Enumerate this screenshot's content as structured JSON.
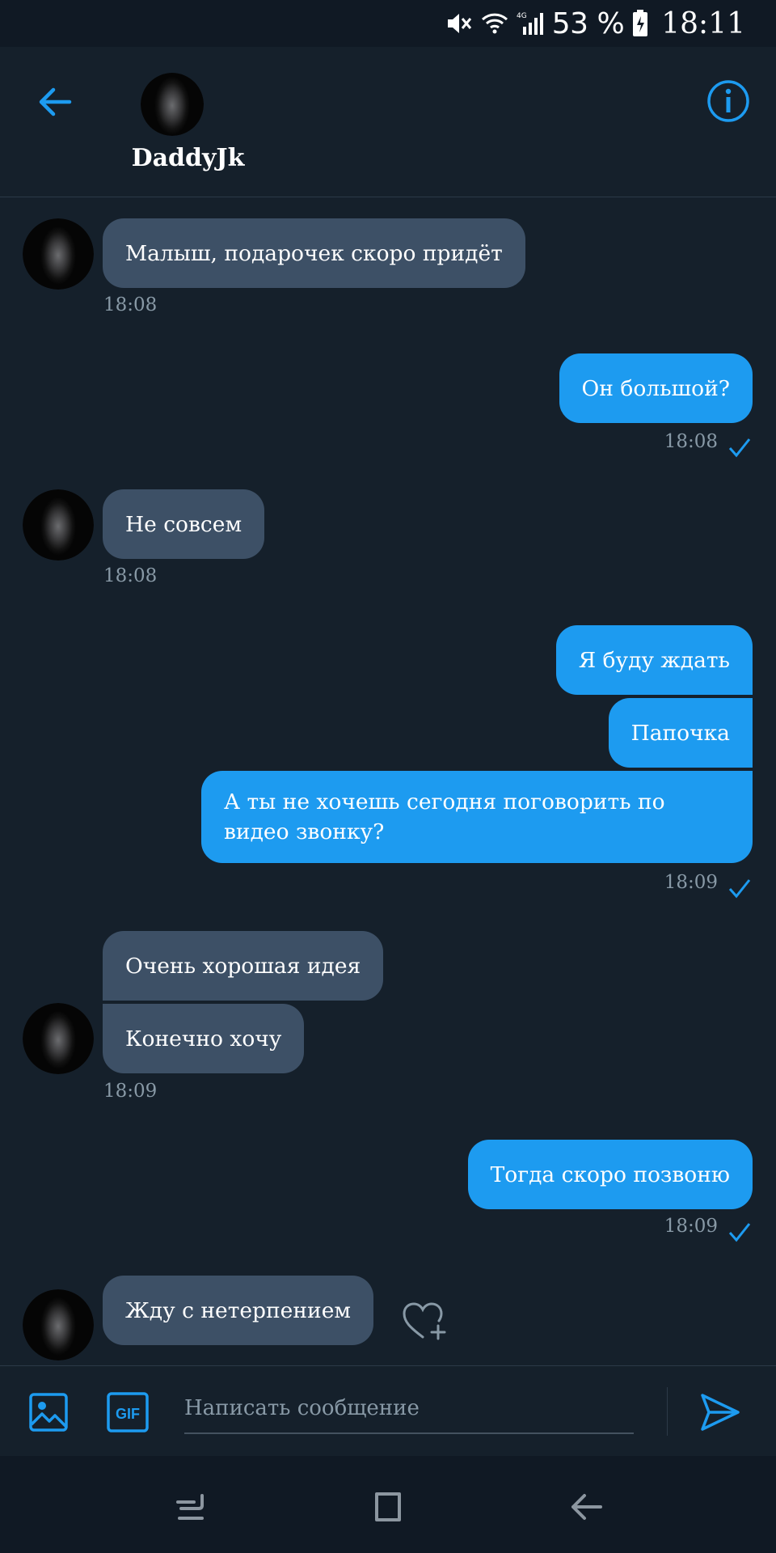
{
  "status_bar": {
    "battery_percent": "53 %",
    "time": "18:11",
    "icons": [
      "mute-icon",
      "wifi-icon",
      "lte-icon",
      "signal-icon",
      "battery-charging-icon"
    ]
  },
  "header": {
    "contact_name": "DaddyJk",
    "icons": [
      "back-arrow-icon",
      "info-icon"
    ]
  },
  "messages": [
    {
      "side": "in",
      "text": "Малыш, подарочек скоро придёт",
      "time": "18:08"
    },
    {
      "side": "out",
      "text": "Он большой?",
      "time": "18:08"
    },
    {
      "side": "in",
      "text": "Не совсем",
      "time": "18:08"
    },
    {
      "side": "out",
      "text": "Я буду ждать"
    },
    {
      "side": "out",
      "text": "Папочка"
    },
    {
      "side": "out",
      "text": "А ты не хочешь сегодня поговорить по видео звонку?",
      "time": "18:09"
    },
    {
      "side": "in",
      "text": "Очень хорошая идея"
    },
    {
      "side": "in",
      "text": "Конечно хочу",
      "time": "18:09"
    },
    {
      "side": "out",
      "text": "Тогда скоро позвоню",
      "time": "18:09"
    },
    {
      "side": "in",
      "text": "Жду с нетерпением"
    }
  ],
  "composer": {
    "placeholder": "Написать сообщение",
    "gif_label": "GIF",
    "icons": [
      "image-icon",
      "gif-icon",
      "send-icon"
    ]
  },
  "colors": {
    "background": "#15202b",
    "incoming_bubble": "#3d5066",
    "outgoing_bubble": "#1d9bf0",
    "accent": "#1d9bf0",
    "secondary_text": "#8899a6"
  }
}
